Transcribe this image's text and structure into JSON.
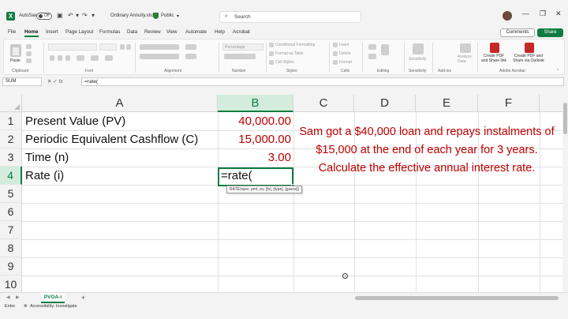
{
  "titlebar": {
    "autosave_label": "AutoSave",
    "autosave_state": "Off",
    "filename": "Ordinary Annuity.xlsx",
    "sensitivity": "Public",
    "search_placeholder": "Search"
  },
  "menu": {
    "items": [
      "File",
      "Home",
      "Insert",
      "Page Layout",
      "Formulas",
      "Data",
      "Review",
      "View",
      "Automate",
      "Help",
      "Acrobat"
    ],
    "active": "Home",
    "comments_label": "Comments",
    "share_label": "Share"
  },
  "ribbon": {
    "paste_label": "Paste",
    "font_name": "",
    "number_format": "Percentage",
    "conditional_formatting": "Conditional Formatting",
    "format_as_table": "Format as Table",
    "cell_styles": "Cell Styles",
    "insert": "Insert",
    "delete": "Delete",
    "format": "Format",
    "sensitivity": "Sensitivity",
    "analyze_data": "Analyze Data",
    "create_pdf_share": "Create PDF and Share link",
    "create_pdf_outlook": "Create PDF and Share via Outlook",
    "groups": {
      "clipboard": "Clipboard",
      "font": "Font",
      "alignment": "Alignment",
      "number": "Number",
      "styles": "Styles",
      "cells": "Cells",
      "editing": "Editing",
      "sensitivity": "Sensitivity",
      "addins": "Add-ins",
      "acrobat": "Adobe Acrobat"
    }
  },
  "formula_bar": {
    "name_box": "SUM",
    "formula": "=rate("
  },
  "grid": {
    "columns": [
      "A",
      "B",
      "C",
      "D",
      "E",
      "F"
    ],
    "rows": [
      "1",
      "2",
      "3",
      "4",
      "5",
      "6",
      "7",
      "8",
      "9",
      "10"
    ],
    "cells": {
      "A1": "Present Value (PV)",
      "B1": "40,000.00",
      "A2": "Periodic Equivalent Cashflow (C)",
      "B2": "15,000.00",
      "A3": "Time (n)",
      "B3": "3.00",
      "A4": "Rate (i)",
      "B4": "=rate("
    },
    "tooltip": "RATE(nper, pmt, pv, [fv], [type], [guess])",
    "problem_text": "Sam got a $40,000 loan and repays instalments of $15,000 at the end of each year for 3 years. Calculate the effective annual interest rate."
  },
  "sheet_tabs": {
    "active": "PVOA-i",
    "add": "+"
  },
  "statusbar": {
    "mode": "Enter",
    "accessibility": "Accessibility: Investigate"
  },
  "colors": {
    "excel_green": "#107c41",
    "value_red": "#c00000"
  }
}
